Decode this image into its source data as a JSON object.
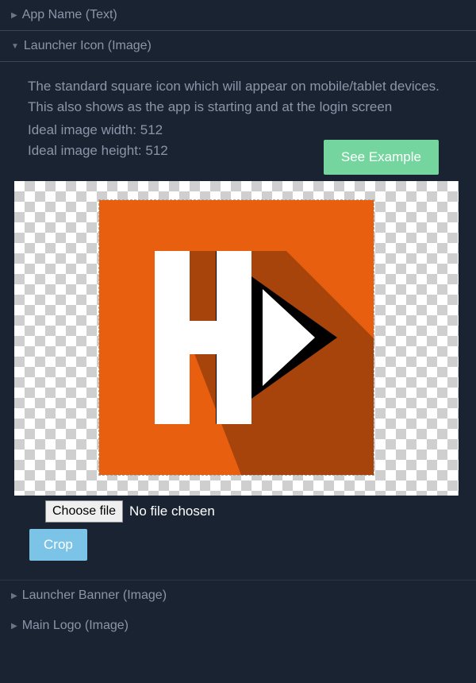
{
  "sections": {
    "app_name": {
      "label": "App Name (Text)"
    },
    "launcher_icon": {
      "label": "Launcher Icon (Image)",
      "description": "The standard square icon which will appear on mobile/tablet devices. This also shows as the app is starting and at the login screen",
      "ideal_width_label": "Ideal image width: 512",
      "ideal_height_label": "Ideal image height: 512",
      "see_example_label": "See Example",
      "choose_file_label": "Choose file",
      "file_status": "No file chosen",
      "crop_label": "Crop",
      "icon_bg_color": "#e85f10"
    },
    "launcher_banner": {
      "label": "Launcher Banner (Image)"
    },
    "main_logo": {
      "label": "Main Logo (Image)"
    }
  }
}
